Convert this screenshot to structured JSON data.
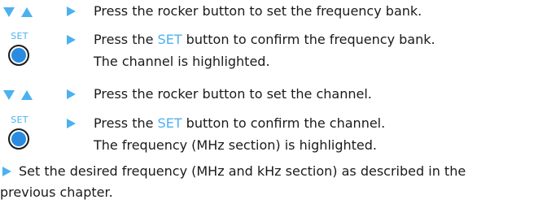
{
  "steps": [
    {
      "icon": "rocker-up-down-icon",
      "text": "Press the rocker button to set the frequency bank."
    },
    {
      "icon": "set-button-icon",
      "icon_caption": "SET",
      "text_before": "Press the ",
      "keyword": "SET",
      "text_after": " button to confirm the frequency bank.",
      "line2": "The channel is highlighted."
    },
    {
      "icon": "rocker-up-down-icon",
      "text": "Press the rocker button to set the channel."
    },
    {
      "icon": "set-button-icon",
      "icon_caption": "SET",
      "text_before": "Press the ",
      "keyword": "SET",
      "text_after": " button to confirm the channel.",
      "line2": "The frequency (MHz section) is highlighted."
    }
  ],
  "final_step": {
    "line1": "Set the desired frequency (MHz and kHz section) as described in the",
    "line2": "previous chapter."
  },
  "colors": {
    "accent": "#4cb1f0",
    "button_fill": "#2a8be0",
    "text": "#1a1a1a"
  }
}
